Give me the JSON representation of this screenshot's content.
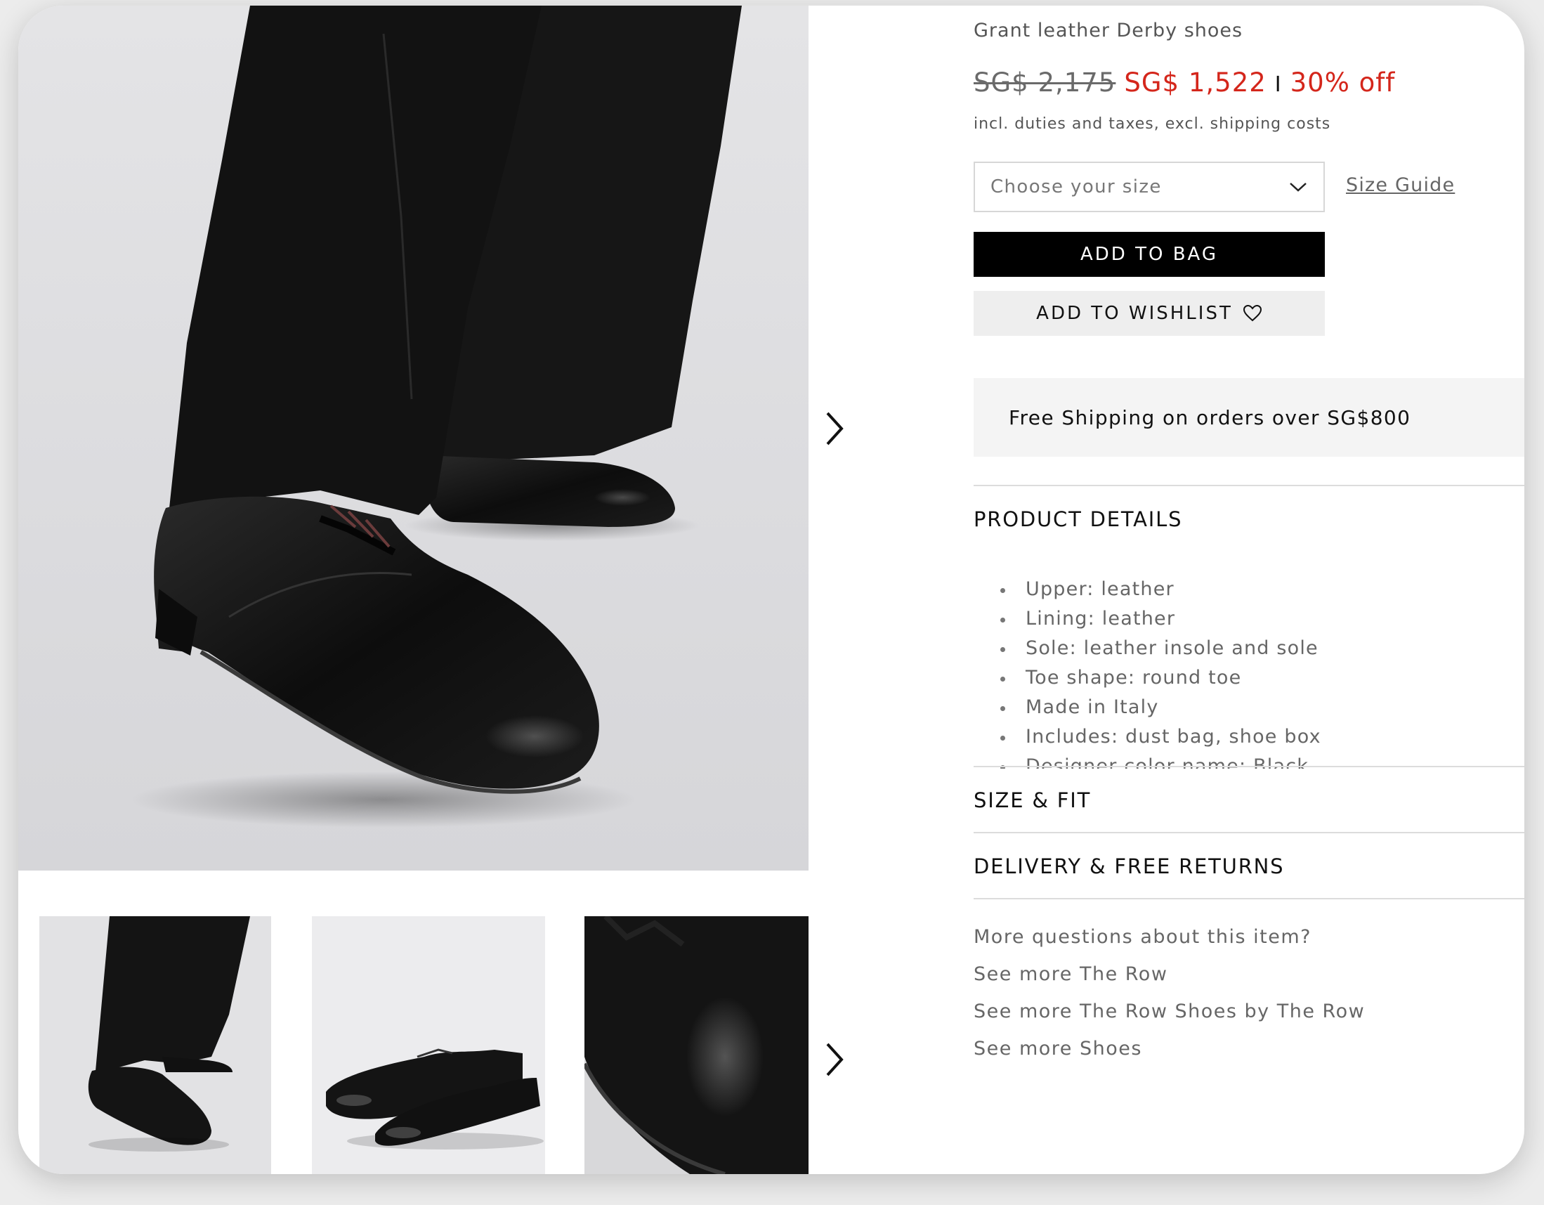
{
  "product": {
    "name": "Grant leather Derby shoes",
    "old_price": "SG$ 2,175",
    "new_price": "SG$ 1,522",
    "separator": "I",
    "discount": "30% off",
    "tax_note": "incl. duties and taxes, excl. shipping costs"
  },
  "size_select": {
    "placeholder": "Choose your size"
  },
  "size_guide_label": "Size Guide",
  "buttons": {
    "add_to_bag": "ADD TO BAG",
    "add_to_wishlist": "ADD TO WISHLIST"
  },
  "shipping_banner": "Free Shipping on orders over SG$800",
  "sections": {
    "product_details": "PRODUCT DETAILS",
    "size_fit": "SIZE & FIT",
    "delivery": "DELIVERY & FREE RETURNS"
  },
  "details": [
    "Upper: leather",
    "Lining: leather",
    "Sole: leather insole and sole",
    "Toe shape: round toe",
    "Made in Italy",
    "Includes: dust bag, shoe box",
    "Designer color name: Black"
  ],
  "more_links": {
    "question": "More questions about this item?",
    "links": [
      "See more The Row",
      "See more The Row Shoes by The Row",
      "See more Shoes"
    ]
  },
  "icons": {
    "next_main": "chevron-right-icon",
    "next_thumbs": "chevron-right-icon",
    "select": "chevron-down-icon",
    "wishlist": "heart-icon"
  },
  "colors": {
    "sale_red": "#d4261b",
    "button_black": "#000000",
    "wishlist_bg": "#eeeeee",
    "banner_bg": "#f4f4f4"
  }
}
